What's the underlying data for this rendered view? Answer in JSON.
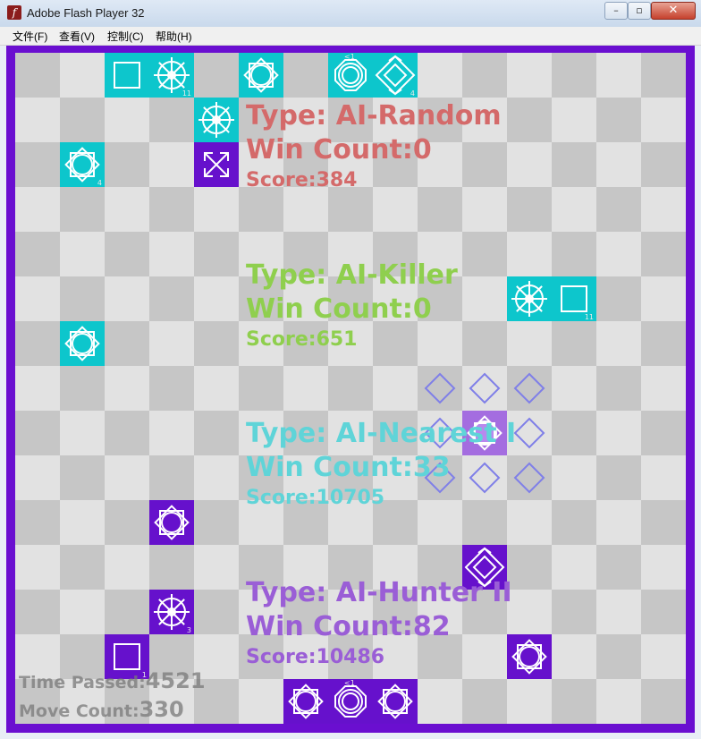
{
  "window": {
    "title": "Adobe Flash Player 32",
    "app_icon": "flash-player-icon"
  },
  "caption_buttons": {
    "minimize": "–",
    "maximize": "▫",
    "close": "✕"
  },
  "menu": [
    {
      "label": "文件(F)"
    },
    {
      "label": "查看(V)"
    },
    {
      "label": "控制(C)"
    },
    {
      "label": "帮助(H)"
    }
  ],
  "players": [
    {
      "type": "Type: AI-Random",
      "win_count": "Win Count:0",
      "score": "Score:384",
      "color": "#d46a6a"
    },
    {
      "type": "Type: AI-Killer",
      "win_count": "Win Count:0",
      "score": "Score:651",
      "color": "#8fcf4e"
    },
    {
      "type": "Type: AI-Nearest I",
      "win_count": "Win Count:33",
      "score": "Score:10705",
      "color": "#5fd4d8"
    },
    {
      "type": "Type: AI-Hunter II",
      "win_count": "Win Count:82",
      "score": "Score:10486",
      "color": "#9a5ed6"
    }
  ],
  "stats": {
    "time_label": "Time Passed:",
    "time_value": "4521",
    "move_label": "Move Count:",
    "move_value": "330"
  },
  "pieces": [
    {
      "row": 0,
      "col": 2,
      "team": "cyan",
      "icon": "square-piece-icon"
    },
    {
      "row": 0,
      "col": 3,
      "team": "cyan",
      "icon": "wheel-piece-icon",
      "label": "11"
    },
    {
      "row": 0,
      "col": 5,
      "team": "cyan",
      "icon": "star-square-piece-icon"
    },
    {
      "row": 0,
      "col": 7,
      "team": "cyan",
      "icon": "octagon-circle-piece-icon",
      "label": "<1"
    },
    {
      "row": 0,
      "col": 8,
      "team": "cyan",
      "icon": "nested-diamond-piece-icon",
      "label": "4"
    },
    {
      "row": 1,
      "col": 4,
      "team": "cyan",
      "icon": "wheel-piece-icon"
    },
    {
      "row": 2,
      "col": 1,
      "team": "cyan",
      "icon": "star-square-piece-icon",
      "label": "4"
    },
    {
      "row": 2,
      "col": 4,
      "team": "purple",
      "icon": "expand-arrows-piece-icon"
    },
    {
      "row": 5,
      "col": 11,
      "team": "cyan",
      "icon": "wheel-piece-icon"
    },
    {
      "row": 5,
      "col": 12,
      "team": "cyan",
      "icon": "square-piece-icon",
      "label": "11"
    },
    {
      "row": 6,
      "col": 1,
      "team": "cyan",
      "icon": "star-square-piece-icon"
    },
    {
      "row": 8,
      "col": 10,
      "team": "lav",
      "icon": "selected-star-piece-icon"
    },
    {
      "row": 10,
      "col": 3,
      "team": "purple",
      "icon": "star-square-piece-icon"
    },
    {
      "row": 11,
      "col": 10,
      "team": "purple",
      "icon": "nested-diamond-piece-icon"
    },
    {
      "row": 12,
      "col": 3,
      "team": "purple",
      "icon": "wheel-piece-icon",
      "label": "3"
    },
    {
      "row": 13,
      "col": 2,
      "team": "purple",
      "icon": "square-piece-icon",
      "label": "1"
    },
    {
      "row": 13,
      "col": 11,
      "team": "purple",
      "icon": "star-square-piece-icon"
    },
    {
      "row": 14,
      "col": 6,
      "team": "purple",
      "icon": "star-square-piece-icon"
    },
    {
      "row": 14,
      "col": 7,
      "team": "purple",
      "icon": "octagon-circle-piece-icon",
      "label": "<1"
    },
    {
      "row": 14,
      "col": 8,
      "team": "purple",
      "icon": "star-square-piece-icon"
    }
  ],
  "move_hints": [
    {
      "row": 7,
      "col": 9
    },
    {
      "row": 7,
      "col": 10
    },
    {
      "row": 7,
      "col": 11
    },
    {
      "row": 8,
      "col": 9
    },
    {
      "row": 8,
      "col": 11
    },
    {
      "row": 9,
      "col": 9
    },
    {
      "row": 9,
      "col": 10
    },
    {
      "row": 9,
      "col": 11
    }
  ]
}
